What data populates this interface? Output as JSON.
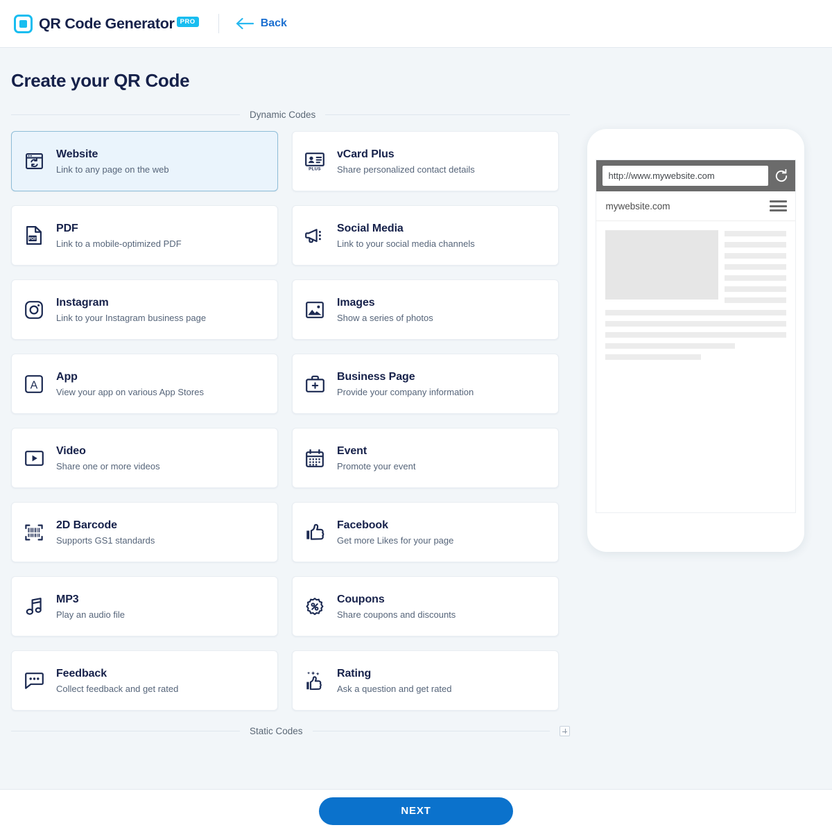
{
  "header": {
    "brand_name": "QR Code Generator",
    "pro_badge": "PRO",
    "back_label": "Back",
    "logo_icon": "qr-logo-icon",
    "back_icon": "arrow-left-icon",
    "accent_cyan": "#18bdf0",
    "accent_blue": "#1b6fd0"
  },
  "page": {
    "title": "Create your QR Code"
  },
  "sections": {
    "dynamic_label": "Dynamic Codes",
    "static_label": "Static Codes",
    "static_expand_icon": "plus-icon"
  },
  "cards": [
    {
      "title": "Website",
      "desc": "Link to any page on the web",
      "icon": "browser-refresh-icon",
      "selected": true,
      "col": "left"
    },
    {
      "title": "vCard Plus",
      "desc": "Share personalized contact details",
      "icon": "id-card-plus-icon",
      "selected": false,
      "col": "right"
    },
    {
      "title": "PDF",
      "desc": "Link to a mobile-optimized PDF",
      "icon": "pdf-file-icon",
      "selected": false,
      "col": "left"
    },
    {
      "title": "Social Media",
      "desc": "Link to your social media channels",
      "icon": "megaphone-icon",
      "selected": false,
      "col": "right"
    },
    {
      "title": "Instagram",
      "desc": "Link to your Instagram business page",
      "icon": "instagram-icon",
      "selected": false,
      "col": "left"
    },
    {
      "title": "Images",
      "desc": "Show a series of photos",
      "icon": "image-icon",
      "selected": false,
      "col": "right"
    },
    {
      "title": "App",
      "desc": "View your app on various App Stores",
      "icon": "app-square-a-icon",
      "selected": false,
      "col": "left"
    },
    {
      "title": "Business Page",
      "desc": "Provide your company information",
      "icon": "briefcase-icon",
      "selected": false,
      "col": "right"
    },
    {
      "title": "Video",
      "desc": "Share one or more videos",
      "icon": "video-play-icon",
      "selected": false,
      "col": "left"
    },
    {
      "title": "Event",
      "desc": "Promote your event",
      "icon": "calendar-icon",
      "selected": false,
      "col": "right"
    },
    {
      "title": "2D Barcode",
      "desc": "Supports GS1 standards",
      "icon": "barcode-2d-icon",
      "selected": false,
      "col": "left"
    },
    {
      "title": "Facebook",
      "desc": "Get more Likes for your page",
      "icon": "thumbs-up-icon",
      "selected": false,
      "col": "right"
    },
    {
      "title": "MP3",
      "desc": "Play an audio file",
      "icon": "music-note-icon",
      "selected": false,
      "col": "left"
    },
    {
      "title": "Coupons",
      "desc": "Share coupons and discounts",
      "icon": "percent-badge-icon",
      "selected": false,
      "col": "right"
    },
    {
      "title": "Feedback",
      "desc": "Collect feedback and get rated",
      "icon": "chat-bubble-icon",
      "selected": false,
      "col": "left"
    },
    {
      "title": "Rating",
      "desc": "Ask a question and get rated",
      "icon": "thumbs-up-stars-icon",
      "selected": false,
      "col": "right"
    }
  ],
  "preview": {
    "url_value": "http://www.mywebsite.com",
    "site_name": "mywebsite.com",
    "reload_icon": "reload-icon",
    "menu_icon": "hamburger-menu-icon"
  },
  "footer": {
    "next_label": "NEXT",
    "next_color": "#0b72cc"
  }
}
